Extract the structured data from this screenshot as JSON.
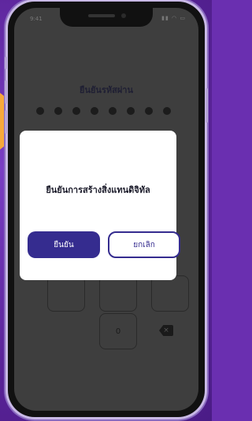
{
  "status_bar": {
    "time": "9:41",
    "icons": "▮▮ ◠ ▭"
  },
  "pin_screen": {
    "title": "ยืนยันรหัสผ่าน",
    "dots_count": 8,
    "visible_key": "0"
  },
  "dialog": {
    "message": "ยืนยันการสร้างสิ่งแทนดิจิทัล",
    "confirm_label": "ยืนยัน",
    "cancel_label": "ยกเลิก"
  }
}
